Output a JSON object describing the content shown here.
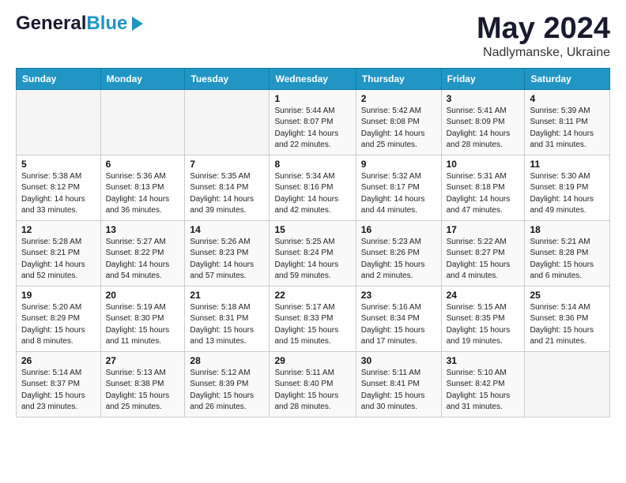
{
  "header": {
    "logo_line1": "General",
    "logo_line2": "Blue",
    "month_title": "May 2024",
    "location": "Nadlymanske, Ukraine"
  },
  "days_of_week": [
    "Sunday",
    "Monday",
    "Tuesday",
    "Wednesday",
    "Thursday",
    "Friday",
    "Saturday"
  ],
  "weeks": [
    [
      {
        "num": "",
        "sunrise": "",
        "sunset": "",
        "daylight": ""
      },
      {
        "num": "",
        "sunrise": "",
        "sunset": "",
        "daylight": ""
      },
      {
        "num": "",
        "sunrise": "",
        "sunset": "",
        "daylight": ""
      },
      {
        "num": "1",
        "sunrise": "Sunrise: 5:44 AM",
        "sunset": "Sunset: 8:07 PM",
        "daylight": "Daylight: 14 hours and 22 minutes."
      },
      {
        "num": "2",
        "sunrise": "Sunrise: 5:42 AM",
        "sunset": "Sunset: 8:08 PM",
        "daylight": "Daylight: 14 hours and 25 minutes."
      },
      {
        "num": "3",
        "sunrise": "Sunrise: 5:41 AM",
        "sunset": "Sunset: 8:09 PM",
        "daylight": "Daylight: 14 hours and 28 minutes."
      },
      {
        "num": "4",
        "sunrise": "Sunrise: 5:39 AM",
        "sunset": "Sunset: 8:11 PM",
        "daylight": "Daylight: 14 hours and 31 minutes."
      }
    ],
    [
      {
        "num": "5",
        "sunrise": "Sunrise: 5:38 AM",
        "sunset": "Sunset: 8:12 PM",
        "daylight": "Daylight: 14 hours and 33 minutes."
      },
      {
        "num": "6",
        "sunrise": "Sunrise: 5:36 AM",
        "sunset": "Sunset: 8:13 PM",
        "daylight": "Daylight: 14 hours and 36 minutes."
      },
      {
        "num": "7",
        "sunrise": "Sunrise: 5:35 AM",
        "sunset": "Sunset: 8:14 PM",
        "daylight": "Daylight: 14 hours and 39 minutes."
      },
      {
        "num": "8",
        "sunrise": "Sunrise: 5:34 AM",
        "sunset": "Sunset: 8:16 PM",
        "daylight": "Daylight: 14 hours and 42 minutes."
      },
      {
        "num": "9",
        "sunrise": "Sunrise: 5:32 AM",
        "sunset": "Sunset: 8:17 PM",
        "daylight": "Daylight: 14 hours and 44 minutes."
      },
      {
        "num": "10",
        "sunrise": "Sunrise: 5:31 AM",
        "sunset": "Sunset: 8:18 PM",
        "daylight": "Daylight: 14 hours and 47 minutes."
      },
      {
        "num": "11",
        "sunrise": "Sunrise: 5:30 AM",
        "sunset": "Sunset: 8:19 PM",
        "daylight": "Daylight: 14 hours and 49 minutes."
      }
    ],
    [
      {
        "num": "12",
        "sunrise": "Sunrise: 5:28 AM",
        "sunset": "Sunset: 8:21 PM",
        "daylight": "Daylight: 14 hours and 52 minutes."
      },
      {
        "num": "13",
        "sunrise": "Sunrise: 5:27 AM",
        "sunset": "Sunset: 8:22 PM",
        "daylight": "Daylight: 14 hours and 54 minutes."
      },
      {
        "num": "14",
        "sunrise": "Sunrise: 5:26 AM",
        "sunset": "Sunset: 8:23 PM",
        "daylight": "Daylight: 14 hours and 57 minutes."
      },
      {
        "num": "15",
        "sunrise": "Sunrise: 5:25 AM",
        "sunset": "Sunset: 8:24 PM",
        "daylight": "Daylight: 14 hours and 59 minutes."
      },
      {
        "num": "16",
        "sunrise": "Sunrise: 5:23 AM",
        "sunset": "Sunset: 8:26 PM",
        "daylight": "Daylight: 15 hours and 2 minutes."
      },
      {
        "num": "17",
        "sunrise": "Sunrise: 5:22 AM",
        "sunset": "Sunset: 8:27 PM",
        "daylight": "Daylight: 15 hours and 4 minutes."
      },
      {
        "num": "18",
        "sunrise": "Sunrise: 5:21 AM",
        "sunset": "Sunset: 8:28 PM",
        "daylight": "Daylight: 15 hours and 6 minutes."
      }
    ],
    [
      {
        "num": "19",
        "sunrise": "Sunrise: 5:20 AM",
        "sunset": "Sunset: 8:29 PM",
        "daylight": "Daylight: 15 hours and 8 minutes."
      },
      {
        "num": "20",
        "sunrise": "Sunrise: 5:19 AM",
        "sunset": "Sunset: 8:30 PM",
        "daylight": "Daylight: 15 hours and 11 minutes."
      },
      {
        "num": "21",
        "sunrise": "Sunrise: 5:18 AM",
        "sunset": "Sunset: 8:31 PM",
        "daylight": "Daylight: 15 hours and 13 minutes."
      },
      {
        "num": "22",
        "sunrise": "Sunrise: 5:17 AM",
        "sunset": "Sunset: 8:33 PM",
        "daylight": "Daylight: 15 hours and 15 minutes."
      },
      {
        "num": "23",
        "sunrise": "Sunrise: 5:16 AM",
        "sunset": "Sunset: 8:34 PM",
        "daylight": "Daylight: 15 hours and 17 minutes."
      },
      {
        "num": "24",
        "sunrise": "Sunrise: 5:15 AM",
        "sunset": "Sunset: 8:35 PM",
        "daylight": "Daylight: 15 hours and 19 minutes."
      },
      {
        "num": "25",
        "sunrise": "Sunrise: 5:14 AM",
        "sunset": "Sunset: 8:36 PM",
        "daylight": "Daylight: 15 hours and 21 minutes."
      }
    ],
    [
      {
        "num": "26",
        "sunrise": "Sunrise: 5:14 AM",
        "sunset": "Sunset: 8:37 PM",
        "daylight": "Daylight: 15 hours and 23 minutes."
      },
      {
        "num": "27",
        "sunrise": "Sunrise: 5:13 AM",
        "sunset": "Sunset: 8:38 PM",
        "daylight": "Daylight: 15 hours and 25 minutes."
      },
      {
        "num": "28",
        "sunrise": "Sunrise: 5:12 AM",
        "sunset": "Sunset: 8:39 PM",
        "daylight": "Daylight: 15 hours and 26 minutes."
      },
      {
        "num": "29",
        "sunrise": "Sunrise: 5:11 AM",
        "sunset": "Sunset: 8:40 PM",
        "daylight": "Daylight: 15 hours and 28 minutes."
      },
      {
        "num": "30",
        "sunrise": "Sunrise: 5:11 AM",
        "sunset": "Sunset: 8:41 PM",
        "daylight": "Daylight: 15 hours and 30 minutes."
      },
      {
        "num": "31",
        "sunrise": "Sunrise: 5:10 AM",
        "sunset": "Sunset: 8:42 PM",
        "daylight": "Daylight: 15 hours and 31 minutes."
      },
      {
        "num": "",
        "sunrise": "",
        "sunset": "",
        "daylight": ""
      }
    ]
  ]
}
